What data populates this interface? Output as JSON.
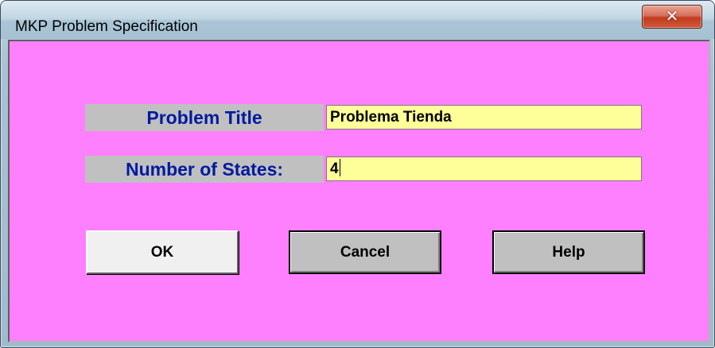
{
  "window": {
    "title": "MKP Problem Specification",
    "close_glyph": "✕"
  },
  "form": {
    "problem_title_label": "Problem Title",
    "problem_title_value": "Problema Tienda",
    "num_states_label": "Number of States:",
    "num_states_value": "4"
  },
  "buttons": {
    "ok_label": "OK",
    "cancel_label": "Cancel",
    "help_label": "Help"
  },
  "colors": {
    "client_background": "#ff80ff",
    "label_background": "#c0c0c0",
    "label_text": "#001a9e",
    "input_background": "#ffff99",
    "close_button": "#c23c20"
  },
  "icons": {
    "close": "close-icon"
  }
}
